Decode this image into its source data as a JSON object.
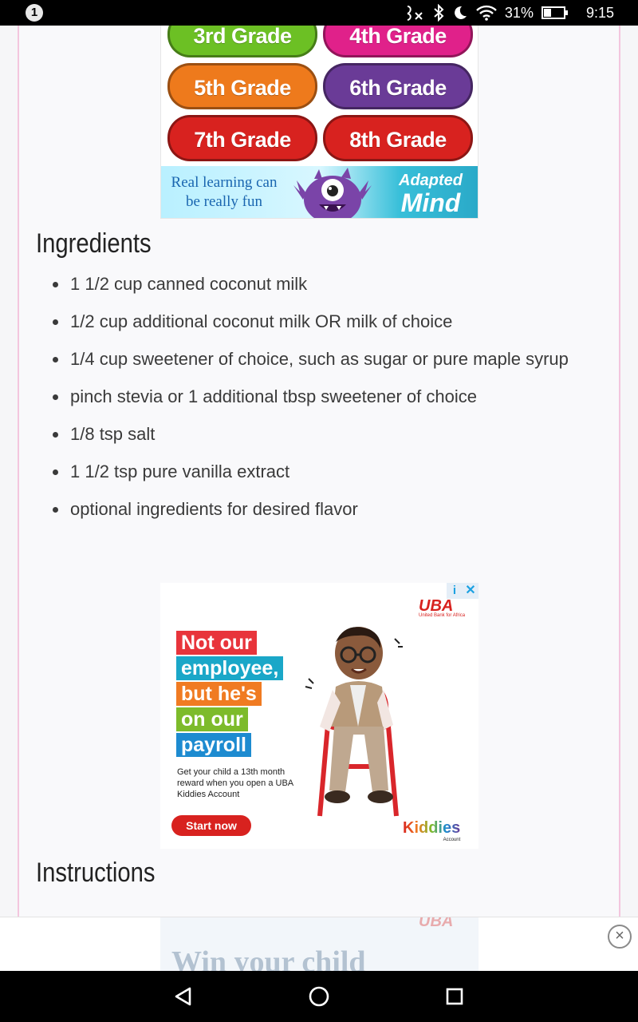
{
  "status_bar": {
    "notification_count": "1",
    "battery_percent": "31%",
    "time": "9:15",
    "icons": [
      "mute-icon",
      "bluetooth-icon",
      "do-not-disturb-icon",
      "wifi-icon",
      "battery-icon"
    ]
  },
  "grade_ad": {
    "buttons": [
      "3rd Grade",
      "4th Grade",
      "5th Grade",
      "6th Grade",
      "7th Grade",
      "8th Grade"
    ],
    "tagline_line1": "Real learning can",
    "tagline_line2": "be really fun",
    "brand_line1": "Adapted",
    "brand_line2": "Mind"
  },
  "recipe": {
    "ingredients_title": "Ingredients",
    "ingredients": [
      "1 1/2 cup canned coconut milk",
      "1/2 cup additional coconut milk OR milk of choice",
      "1/4 cup sweetener of choice, such as sugar or pure maple syrup",
      "pinch stevia or 1 additional tbsp sweetener of choice",
      "1/8 tsp salt",
      "1 1/2 tsp pure vanilla extract",
      "optional ingredients for desired flavor"
    ],
    "instructions_title": "Instructions"
  },
  "uba_ad": {
    "logo": "UBA",
    "logo_sub": "United Bank for Africa",
    "headline_lines": [
      "Not our",
      "employee,",
      "but he's",
      "on our",
      "payroll"
    ],
    "body": "Get your child a 13th month reward when you open a UBA Kiddies Account",
    "cta": "Start now",
    "product": "Kiddies",
    "product_sub": "Account",
    "adchoices_info": "i",
    "adchoices_close": "✕"
  },
  "bottom_ad": {
    "logo": "UBA",
    "headline": "Win your child",
    "close": "×"
  },
  "colors": {
    "page_border": "#f3c6de",
    "uba_red": "#d8221f"
  }
}
